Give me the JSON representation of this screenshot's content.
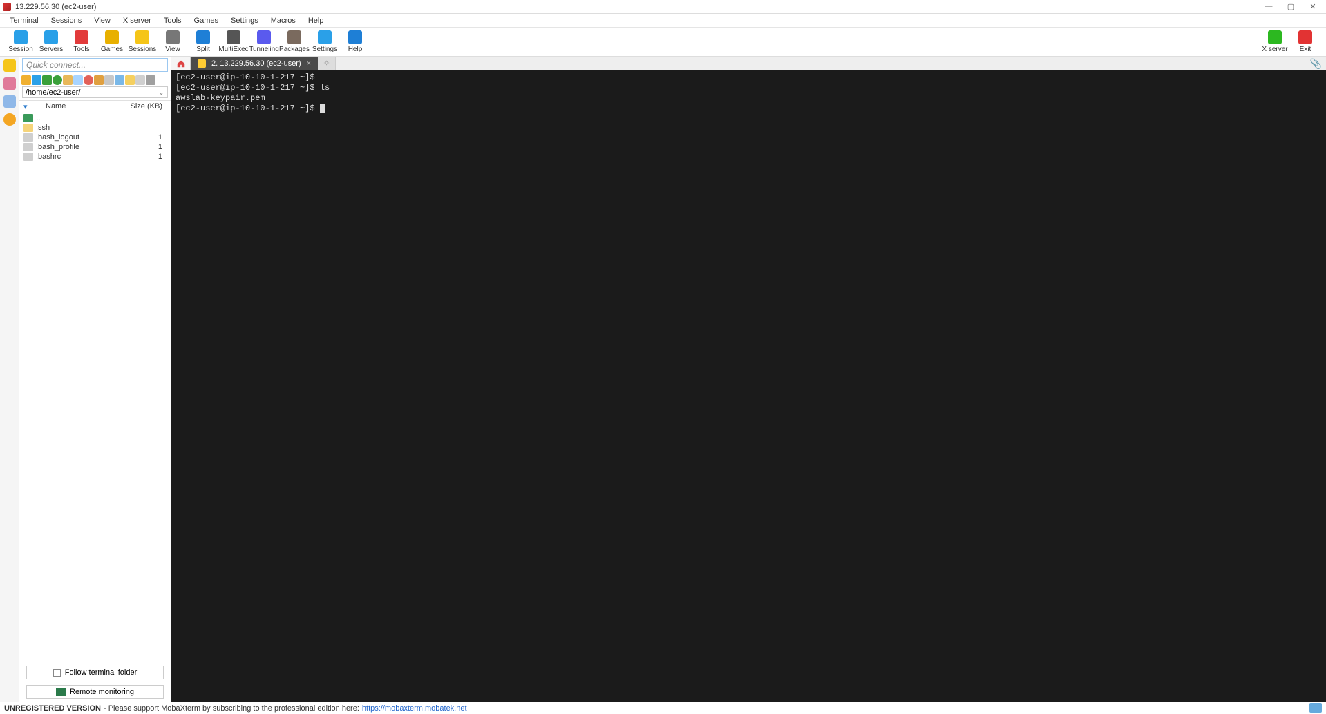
{
  "window": {
    "title": "13.229.56.30 (ec2-user)"
  },
  "menu": [
    "Terminal",
    "Sessions",
    "View",
    "X server",
    "Tools",
    "Games",
    "Settings",
    "Macros",
    "Help"
  ],
  "tools": [
    {
      "label": "Session",
      "color": "#2aa0e8"
    },
    {
      "label": "Servers",
      "color": "#2aa0e8"
    },
    {
      "label": "Tools",
      "color": "#e23b3b"
    },
    {
      "label": "Games",
      "color": "#e8b000"
    },
    {
      "label": "Sessions",
      "color": "#f5c518"
    },
    {
      "label": "View",
      "color": "#777"
    },
    {
      "label": "Split",
      "color": "#1e7fd6"
    },
    {
      "label": "MultiExec",
      "color": "#555"
    },
    {
      "label": "Tunneling",
      "color": "#5a5aee"
    },
    {
      "label": "Packages",
      "color": "#7a6a5e"
    },
    {
      "label": "Settings",
      "color": "#2aa0e8"
    },
    {
      "label": "Help",
      "color": "#1e7fd6"
    }
  ],
  "tools_right": [
    {
      "label": "X server",
      "color": "#2cb820"
    },
    {
      "label": "Exit",
      "color": "#e23333"
    }
  ],
  "quick_connect_placeholder": "Quick connect...",
  "sftp": {
    "path": "/home/ec2-user/",
    "columns": {
      "name": "Name",
      "size": "Size (KB)"
    },
    "files": [
      {
        "name": "..",
        "size": "",
        "type": "up",
        "color": "#3a9a5a"
      },
      {
        "name": ".ssh",
        "size": "",
        "type": "dir",
        "color": "#f5d47a"
      },
      {
        "name": ".bash_logout",
        "size": "1",
        "type": "file",
        "color": "#cfcfcf"
      },
      {
        "name": ".bash_profile",
        "size": "1",
        "type": "file",
        "color": "#cfcfcf"
      },
      {
        "name": ".bashrc",
        "size": "1",
        "type": "file",
        "color": "#cfcfcf"
      }
    ],
    "follow_label": "Follow terminal folder",
    "remote_monitor": "Remote monitoring"
  },
  "tabs": {
    "active": "2. 13.229.56.30 (ec2-user)"
  },
  "terminal_lines": [
    "[ec2-user@ip-10-10-1-217 ~]$",
    "[ec2-user@ip-10-10-1-217 ~]$ ls",
    "awslab-keypair.pem",
    "[ec2-user@ip-10-10-1-217 ~]$ "
  ],
  "status": {
    "label": "UNREGISTERED VERSION",
    "text": " - Please support MobaXterm by subscribing to the professional edition here: ",
    "link": "https://mobaxterm.mobatek.net"
  }
}
